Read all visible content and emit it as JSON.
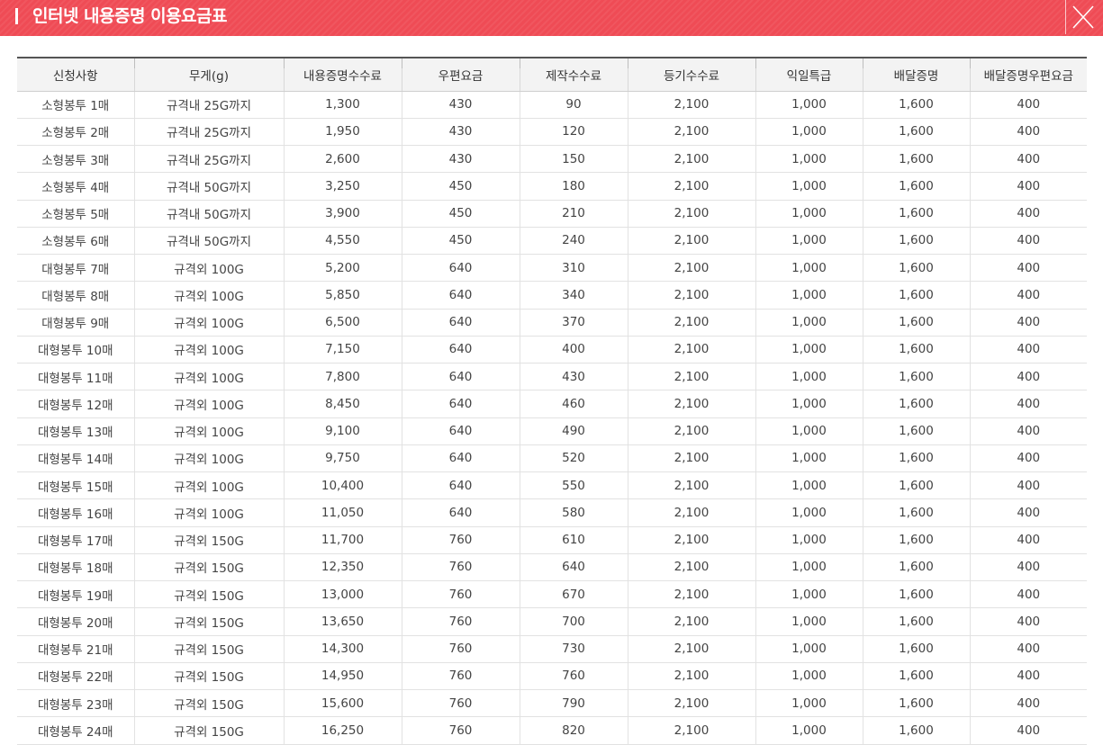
{
  "header": {
    "title": "인터넷 내용증명 이용요금표",
    "accent_color": "#ef4b55",
    "close_icon": "close-icon"
  },
  "table": {
    "columns": [
      "신청사항",
      "무게(g)",
      "내용증명수수료",
      "우편요금",
      "제작수수료",
      "등기수수료",
      "익일특급",
      "배달증명",
      "배달증명우편요금"
    ],
    "rows": [
      [
        "소형봉투 1매",
        "규격내 25G까지",
        "1,300",
        "430",
        "90",
        "2,100",
        "1,000",
        "1,600",
        "400"
      ],
      [
        "소형봉투 2매",
        "규격내 25G까지",
        "1,950",
        "430",
        "120",
        "2,100",
        "1,000",
        "1,600",
        "400"
      ],
      [
        "소형봉투 3매",
        "규격내 25G까지",
        "2,600",
        "430",
        "150",
        "2,100",
        "1,000",
        "1,600",
        "400"
      ],
      [
        "소형봉투 4매",
        "규격내 50G까지",
        "3,250",
        "450",
        "180",
        "2,100",
        "1,000",
        "1,600",
        "400"
      ],
      [
        "소형봉투 5매",
        "규격내 50G까지",
        "3,900",
        "450",
        "210",
        "2,100",
        "1,000",
        "1,600",
        "400"
      ],
      [
        "소형봉투 6매",
        "규격내 50G까지",
        "4,550",
        "450",
        "240",
        "2,100",
        "1,000",
        "1,600",
        "400"
      ],
      [
        "대형봉투 7매",
        "규격외 100G",
        "5,200",
        "640",
        "310",
        "2,100",
        "1,000",
        "1,600",
        "400"
      ],
      [
        "대형봉투 8매",
        "규격외 100G",
        "5,850",
        "640",
        "340",
        "2,100",
        "1,000",
        "1,600",
        "400"
      ],
      [
        "대형봉투 9매",
        "규격외 100G",
        "6,500",
        "640",
        "370",
        "2,100",
        "1,000",
        "1,600",
        "400"
      ],
      [
        "대형봉투 10매",
        "규격외 100G",
        "7,150",
        "640",
        "400",
        "2,100",
        "1,000",
        "1,600",
        "400"
      ],
      [
        "대형봉투 11매",
        "규격외 100G",
        "7,800",
        "640",
        "430",
        "2,100",
        "1,000",
        "1,600",
        "400"
      ],
      [
        "대형봉투 12매",
        "규격외 100G",
        "8,450",
        "640",
        "460",
        "2,100",
        "1,000",
        "1,600",
        "400"
      ],
      [
        "대형봉투 13매",
        "규격외 100G",
        "9,100",
        "640",
        "490",
        "2,100",
        "1,000",
        "1,600",
        "400"
      ],
      [
        "대형봉투 14매",
        "규격외 100G",
        "9,750",
        "640",
        "520",
        "2,100",
        "1,000",
        "1,600",
        "400"
      ],
      [
        "대형봉투 15매",
        "규격외 100G",
        "10,400",
        "640",
        "550",
        "2,100",
        "1,000",
        "1,600",
        "400"
      ],
      [
        "대형봉투 16매",
        "규격외 100G",
        "11,050",
        "640",
        "580",
        "2,100",
        "1,000",
        "1,600",
        "400"
      ],
      [
        "대형봉투 17매",
        "규격외 150G",
        "11,700",
        "760",
        "610",
        "2,100",
        "1,000",
        "1,600",
        "400"
      ],
      [
        "대형봉투 18매",
        "규격외 150G",
        "12,350",
        "760",
        "640",
        "2,100",
        "1,000",
        "1,600",
        "400"
      ],
      [
        "대형봉투 19매",
        "규격외 150G",
        "13,000",
        "760",
        "670",
        "2,100",
        "1,000",
        "1,600",
        "400"
      ],
      [
        "대형봉투 20매",
        "규격외 150G",
        "13,650",
        "760",
        "700",
        "2,100",
        "1,000",
        "1,600",
        "400"
      ],
      [
        "대형봉투 21매",
        "규격외 150G",
        "14,300",
        "760",
        "730",
        "2,100",
        "1,000",
        "1,600",
        "400"
      ],
      [
        "대형봉투 22매",
        "규격외 150G",
        "14,950",
        "760",
        "760",
        "2,100",
        "1,000",
        "1,600",
        "400"
      ],
      [
        "대형봉투 23매",
        "규격외 150G",
        "15,600",
        "760",
        "790",
        "2,100",
        "1,000",
        "1,600",
        "400"
      ],
      [
        "대형봉투 24매",
        "규격외 150G",
        "16,250",
        "760",
        "820",
        "2,100",
        "1,000",
        "1,600",
        "400"
      ]
    ]
  }
}
